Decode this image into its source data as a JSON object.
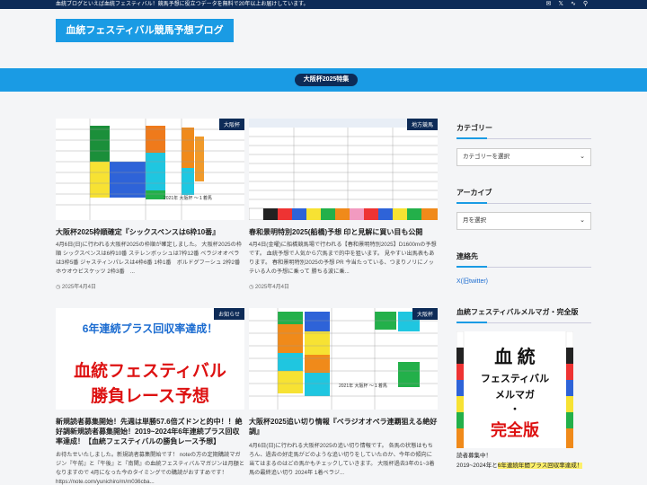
{
  "topbar": {
    "text": "血統ブログといえば血統フェスティバル！競馬予想に役立つデータを無料で20年以上お届けしています。",
    "icons": [
      "mail-icon",
      "x-icon",
      "rss-icon",
      "search-icon"
    ]
  },
  "site": {
    "title": "血統フェスティバル競馬予想ブログ"
  },
  "feature": {
    "label": "大阪杯2025特集"
  },
  "colors": {
    "navy": "#0d2b57",
    "accent": "#1a9be4",
    "highlight": "#fdf06c"
  },
  "posts": [
    {
      "category": "大阪杯",
      "title": "大阪杯2025枠順確定『シックスペンスは6枠10番』",
      "excerpt": "4月6日(日)に行われる大阪杯2025の枠順が確定しました。 大阪杯2025の枠順 シックスペンスは6枠10番 ステレンボッシュは7枠12番 ベラジオオペラは3枠5番 ジャスティンパレスは4枠6番 1枠1番　ボルドグフーシュ 2枠2番　ホウオウビスケッツ 2枠3番　...",
      "date": "2025年4月4日",
      "thumb_caption": "2021年 大阪杯 ～１着馬"
    },
    {
      "category": "地方競馬",
      "title": "春和景明特別2025(船橋)予想 印と見解に買い目も公開",
      "excerpt": "4月4日(金曜)に船橋競馬場で行われる【春和景明特別2025】D1600mの予想です。 血統予想で人気から穴馬まで的中を狙います。 見やすい出馬表もあります。 春和景明特別2025の予想 PR 今当たっている、つまりノリにノッテいる人の予想に乗って 勝ちる波に乗...",
      "date": "2025年4月4日"
    },
    {
      "category": "お知らせ",
      "title": "新規読者募集開始！先週は単勝57.6倍ズドンと的中！！絶好調新規読者募集開始！2019~2024年6年連続プラス回収率達成！【血統フェスティバルの勝負レース予想】",
      "excerpt": "お待たせいたしました。新規読者募集開始です！ noteの方の定期購読マガジン『午前』と『午後』と『南関』の血統フェスティバルマガジンは月額となりますので 4月になった今のタイミングでの購読がおすすめです！ https://note.com/yunichiro/m/m036cba...",
      "thumb_line1": "6年連続プラス回収率達成！",
      "thumb_line2": "血統フェスティバル",
      "thumb_line3": "勝負レース予想"
    },
    {
      "category": "大阪杯",
      "title": "大阪杯2025追い切り情報『ベラジオオペラ連覇狙える絶好調』",
      "excerpt": "4月6日(日)に行われる大阪杯2025の追い切り情報です。 各馬の状態はもちろん、過去の好走馬がどのような追い切りをしていたのか、今年の傾向に当てはまるのはどの馬かもチェックしていきます。 大阪杯過去3年の1~3着馬の最終追い切り 2024年 1着ベラジ...",
      "thumb_caption": "2021年 大阪杯 ～１着馬"
    }
  ],
  "sidebar": {
    "category_heading": "カテゴリー",
    "category_select": "カテゴリーを選択",
    "archive_heading": "アーカイブ",
    "archive_select": "月を選択",
    "contact_heading": "連絡先",
    "contact_link": "X(旧twitter)",
    "mag_heading": "血統フェスティバルメルマガ・完全版",
    "mag_line1": "血 統",
    "mag_line2": "フェスティバル",
    "mag_line3": "メルマガ",
    "mag_line4": "・",
    "mag_line5": "完全版",
    "text_intro": "読者募集中！",
    "text_plain": "2019~2024年と",
    "text_highlight": "6年連続年間プラス回収率達成！"
  }
}
